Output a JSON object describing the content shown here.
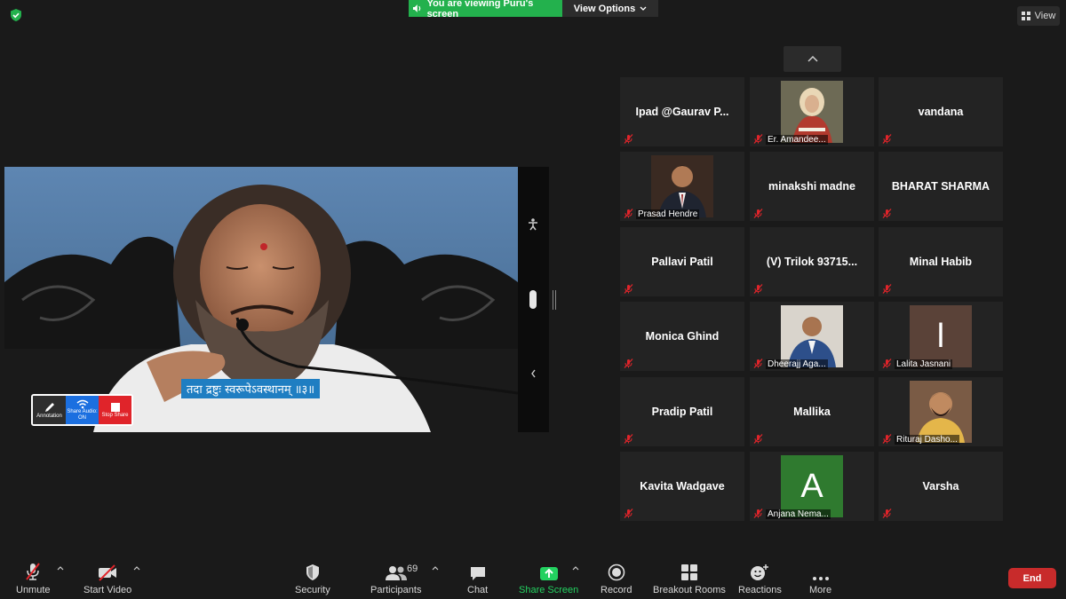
{
  "header": {
    "banner_text": "You are viewing Puru's screen",
    "view_options_label": "View Options",
    "view_label": "View"
  },
  "share": {
    "subtitle": "तदा द्रष्टुः स्वरूपेऽवस्थानम् ॥३॥",
    "annotation_label": "Annotation",
    "share_audio_label": "Share Audio:",
    "share_audio_state": "ON",
    "stop_share_label": "Stop Share"
  },
  "participants": [
    {
      "name": "Ipad  @Gaurav  P...",
      "type": "name"
    },
    {
      "name": "Er. Amandee...",
      "type": "photo"
    },
    {
      "name": "vandana",
      "type": "name"
    },
    {
      "name": "Prasad Hendre",
      "type": "photo"
    },
    {
      "name": "minakshi madne",
      "type": "name"
    },
    {
      "name": "BHARAT SHARMA",
      "type": "name"
    },
    {
      "name": "Pallavi Patil",
      "type": "name"
    },
    {
      "name": "(V)  Trilok 93715...",
      "type": "name"
    },
    {
      "name": "Minal Habib",
      "type": "name"
    },
    {
      "name": "Monica Ghind",
      "type": "name"
    },
    {
      "name": "Dheerajj Aga...",
      "type": "photo"
    },
    {
      "name": "Lalita Jasnani",
      "type": "letter",
      "letter": "l"
    },
    {
      "name": "Pradip Patil",
      "type": "name"
    },
    {
      "name": "Mallika",
      "type": "name"
    },
    {
      "name": "Rituraj Dasho...",
      "type": "photo"
    },
    {
      "name": "Kavita Wadgave",
      "type": "name"
    },
    {
      "name": "Anjana Nema...",
      "type": "letter",
      "letter": "A"
    },
    {
      "name": "Varsha",
      "type": "name"
    }
  ],
  "toolbar": {
    "unmute": "Unmute",
    "start_video": "Start Video",
    "security": "Security",
    "participants": "Participants",
    "participants_count": "69",
    "chat": "Chat",
    "share_screen": "Share Screen",
    "record": "Record",
    "breakout_rooms": "Breakout Rooms",
    "reactions": "Reactions",
    "more": "More",
    "end": "End"
  },
  "colors": {
    "banner_green": "#23b14d",
    "share_green": "#23d160",
    "end_red": "#c82b2b",
    "muted_red": "#e0242a",
    "subtitle_blue": "#1f7ec2",
    "letter_l_bg": "#5a4238",
    "letter_a_bg": "#2f7a2f"
  }
}
